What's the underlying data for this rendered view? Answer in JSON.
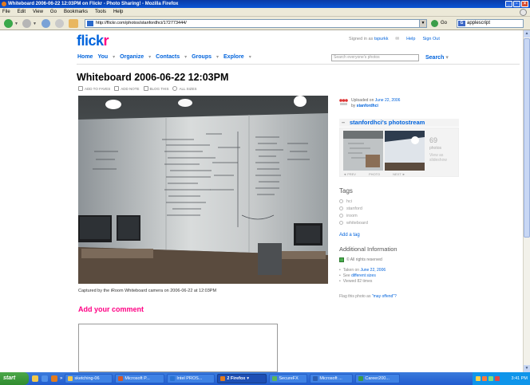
{
  "window": {
    "title": "Whiteboard 2006-06-22 12:03PM on Flickr - Photo Sharing! - Mozilla Firefox"
  },
  "menubar": {
    "items": [
      "File",
      "Edit",
      "View",
      "Go",
      "Bookmarks",
      "Tools",
      "Help"
    ]
  },
  "navbar": {
    "url": "http://flickr.com/photos/stanfordhci/172773444/",
    "go_label": "Go",
    "search_value": "applescript"
  },
  "site": {
    "logo_main": "flick",
    "logo_accent": "r",
    "nav": [
      "Home",
      "You",
      "Organize",
      "Contacts",
      "Groups",
      "Explore"
    ],
    "signed_in_prefix": "Signed in as",
    "user": "tspurkk",
    "help": "Help",
    "sign_out": "Sign Out",
    "search_placeholder": "Search everyone's photos",
    "search_label": "Search"
  },
  "photo": {
    "title": "Whiteboard 2006-06-22 12:03PM",
    "tools": [
      "ADD TO FAVES",
      "ADD NOTE",
      "BLOG THIS",
      "ALL SIZES"
    ],
    "caption": "Captured by the iRoom Whiteboard camera on 2006-06-22 at 12:03PM"
  },
  "comment": {
    "heading": "Add your comment"
  },
  "sidebar": {
    "uploaded_prefix": "Uploaded on",
    "uploaded_date": "June 22, 2006",
    "by": "by",
    "owner": "stanfordhci",
    "photostream_label": "stanfordhci's photostream",
    "photo_count": "69",
    "photos_word": "photos",
    "view_as": "View as slideshow",
    "nav_prev": "◄ PREV",
    "nav_current": "PHOTO",
    "nav_next": "NEXT ►",
    "tags_heading": "Tags",
    "tags": [
      "hci",
      "stanford",
      "iroom",
      "whiteboard"
    ],
    "add_tag": "Add a tag",
    "addinfo_heading": "Additional Information",
    "rights": "© All rights reserved",
    "taken_prefix": "Taken on",
    "taken_date": "June 22, 2006",
    "see_prefix": "See",
    "see_link": "different sizes",
    "viewed": "Viewed 82 times",
    "flag_prefix": "Flag this photo as",
    "flag_link": "\"may offend\"?"
  },
  "taskbar": {
    "start": "start",
    "tasks": [
      "sketching-06",
      "Microsoft P...",
      "Intel PROS...",
      "2 Firefox",
      "SecureFX",
      "Microsoft ...",
      "Career200..."
    ],
    "clock": "3:41 PM"
  }
}
